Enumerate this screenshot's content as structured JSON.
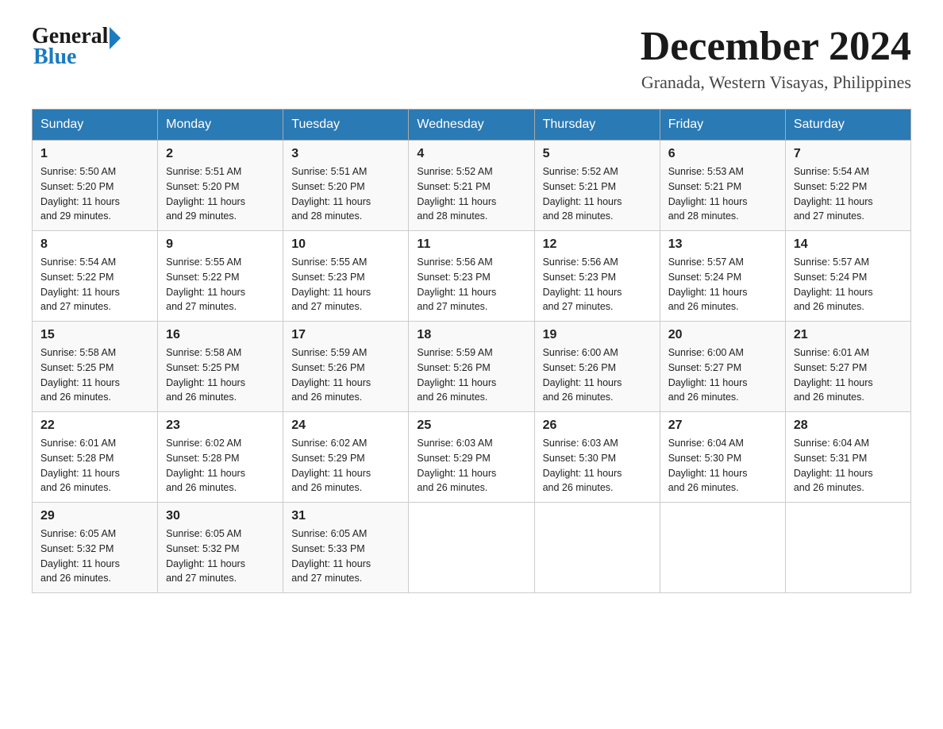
{
  "header": {
    "logo_general": "General",
    "logo_blue": "Blue",
    "month": "December 2024",
    "location": "Granada, Western Visayas, Philippines"
  },
  "days_of_week": [
    "Sunday",
    "Monday",
    "Tuesday",
    "Wednesday",
    "Thursday",
    "Friday",
    "Saturday"
  ],
  "weeks": [
    [
      {
        "day": "1",
        "sunrise": "5:50 AM",
        "sunset": "5:20 PM",
        "daylight": "11 hours and 29 minutes."
      },
      {
        "day": "2",
        "sunrise": "5:51 AM",
        "sunset": "5:20 PM",
        "daylight": "11 hours and 29 minutes."
      },
      {
        "day": "3",
        "sunrise": "5:51 AM",
        "sunset": "5:20 PM",
        "daylight": "11 hours and 28 minutes."
      },
      {
        "day": "4",
        "sunrise": "5:52 AM",
        "sunset": "5:21 PM",
        "daylight": "11 hours and 28 minutes."
      },
      {
        "day": "5",
        "sunrise": "5:52 AM",
        "sunset": "5:21 PM",
        "daylight": "11 hours and 28 minutes."
      },
      {
        "day": "6",
        "sunrise": "5:53 AM",
        "sunset": "5:21 PM",
        "daylight": "11 hours and 28 minutes."
      },
      {
        "day": "7",
        "sunrise": "5:54 AM",
        "sunset": "5:22 PM",
        "daylight": "11 hours and 27 minutes."
      }
    ],
    [
      {
        "day": "8",
        "sunrise": "5:54 AM",
        "sunset": "5:22 PM",
        "daylight": "11 hours and 27 minutes."
      },
      {
        "day": "9",
        "sunrise": "5:55 AM",
        "sunset": "5:22 PM",
        "daylight": "11 hours and 27 minutes."
      },
      {
        "day": "10",
        "sunrise": "5:55 AM",
        "sunset": "5:23 PM",
        "daylight": "11 hours and 27 minutes."
      },
      {
        "day": "11",
        "sunrise": "5:56 AM",
        "sunset": "5:23 PM",
        "daylight": "11 hours and 27 minutes."
      },
      {
        "day": "12",
        "sunrise": "5:56 AM",
        "sunset": "5:23 PM",
        "daylight": "11 hours and 27 minutes."
      },
      {
        "day": "13",
        "sunrise": "5:57 AM",
        "sunset": "5:24 PM",
        "daylight": "11 hours and 26 minutes."
      },
      {
        "day": "14",
        "sunrise": "5:57 AM",
        "sunset": "5:24 PM",
        "daylight": "11 hours and 26 minutes."
      }
    ],
    [
      {
        "day": "15",
        "sunrise": "5:58 AM",
        "sunset": "5:25 PM",
        "daylight": "11 hours and 26 minutes."
      },
      {
        "day": "16",
        "sunrise": "5:58 AM",
        "sunset": "5:25 PM",
        "daylight": "11 hours and 26 minutes."
      },
      {
        "day": "17",
        "sunrise": "5:59 AM",
        "sunset": "5:26 PM",
        "daylight": "11 hours and 26 minutes."
      },
      {
        "day": "18",
        "sunrise": "5:59 AM",
        "sunset": "5:26 PM",
        "daylight": "11 hours and 26 minutes."
      },
      {
        "day": "19",
        "sunrise": "6:00 AM",
        "sunset": "5:26 PM",
        "daylight": "11 hours and 26 minutes."
      },
      {
        "day": "20",
        "sunrise": "6:00 AM",
        "sunset": "5:27 PM",
        "daylight": "11 hours and 26 minutes."
      },
      {
        "day": "21",
        "sunrise": "6:01 AM",
        "sunset": "5:27 PM",
        "daylight": "11 hours and 26 minutes."
      }
    ],
    [
      {
        "day": "22",
        "sunrise": "6:01 AM",
        "sunset": "5:28 PM",
        "daylight": "11 hours and 26 minutes."
      },
      {
        "day": "23",
        "sunrise": "6:02 AM",
        "sunset": "5:28 PM",
        "daylight": "11 hours and 26 minutes."
      },
      {
        "day": "24",
        "sunrise": "6:02 AM",
        "sunset": "5:29 PM",
        "daylight": "11 hours and 26 minutes."
      },
      {
        "day": "25",
        "sunrise": "6:03 AM",
        "sunset": "5:29 PM",
        "daylight": "11 hours and 26 minutes."
      },
      {
        "day": "26",
        "sunrise": "6:03 AM",
        "sunset": "5:30 PM",
        "daylight": "11 hours and 26 minutes."
      },
      {
        "day": "27",
        "sunrise": "6:04 AM",
        "sunset": "5:30 PM",
        "daylight": "11 hours and 26 minutes."
      },
      {
        "day": "28",
        "sunrise": "6:04 AM",
        "sunset": "5:31 PM",
        "daylight": "11 hours and 26 minutes."
      }
    ],
    [
      {
        "day": "29",
        "sunrise": "6:05 AM",
        "sunset": "5:32 PM",
        "daylight": "11 hours and 26 minutes."
      },
      {
        "day": "30",
        "sunrise": "6:05 AM",
        "sunset": "5:32 PM",
        "daylight": "11 hours and 27 minutes."
      },
      {
        "day": "31",
        "sunrise": "6:05 AM",
        "sunset": "5:33 PM",
        "daylight": "11 hours and 27 minutes."
      },
      null,
      null,
      null,
      null
    ]
  ],
  "labels": {
    "sunrise": "Sunrise:",
    "sunset": "Sunset:",
    "daylight": "Daylight:"
  }
}
